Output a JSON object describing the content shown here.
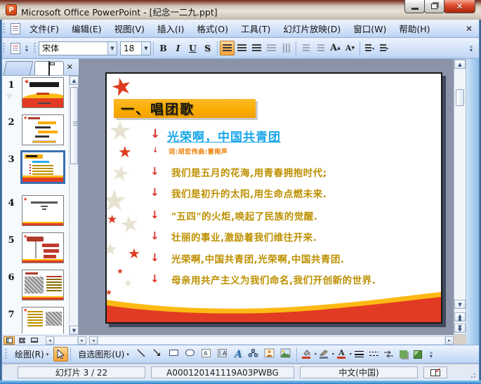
{
  "window": {
    "title": "Microsoft Office PowerPoint - [纪念一二九.ppt]"
  },
  "menu_bar": {
    "items": [
      "文件(F)",
      "编辑(E)",
      "视图(V)",
      "插入(I)",
      "格式(O)",
      "工具(T)",
      "幻灯片放映(D)",
      "窗口(W)",
      "帮助(H)"
    ],
    "close_label": "✕"
  },
  "format_toolbar": {
    "font_name": "宋体",
    "font_size": "18",
    "bold_label": "B",
    "italic_label": "I",
    "underline_label": "U",
    "shadow_label": "S",
    "grow_font_label": "A",
    "shrink_font_label": "A"
  },
  "slides_panel": {
    "slide_numbers": [
      "1",
      "2",
      "3",
      "4",
      "5",
      "6",
      "7"
    ],
    "selected_slide": "3"
  },
  "slide": {
    "title": "一、唱团歌",
    "bullets": [
      {
        "text": "光荣啊，中国共青团",
        "style": "link"
      },
      {
        "text": "词:胡宏伟曲:雷雨声",
        "style": "credit"
      },
      {
        "text": "我们是五月的花海,用青春拥抱时代;",
        "style": "lyric"
      },
      {
        "text": "我们是初升的太阳,用生命点燃未来.",
        "style": "lyric"
      },
      {
        "text": "\"五四\"的火炬,唤起了民族的觉醒.",
        "style": "lyric"
      },
      {
        "text": "壮丽的事业,激励着我们维往开来.",
        "style": "lyric"
      },
      {
        "text": "光荣啊,中国共青团,光荣啊,中国共青团.",
        "style": "lyric"
      },
      {
        "text": "母亲用共产主义为我们命名,我们开创新的世界.",
        "style": "lyric"
      }
    ]
  },
  "drawing_toolbar": {
    "draw_label": "绘图(R)",
    "autoshapes_label": "自选图形(U)"
  },
  "status_bar": {
    "slide_position": "幻灯片 3 / 22",
    "document_code": "A000120141119A03PWBG",
    "language": "中文(中国)"
  },
  "colors": {
    "banner-orange": "#F9AE00",
    "wave-yellow": "#FDB913",
    "wave-red": "#E23B24",
    "link-blue": "#1BA7E8",
    "lyric-gold": "#BD9000",
    "arrow-red": "#D93025",
    "selected-orange": "#FDB759"
  }
}
